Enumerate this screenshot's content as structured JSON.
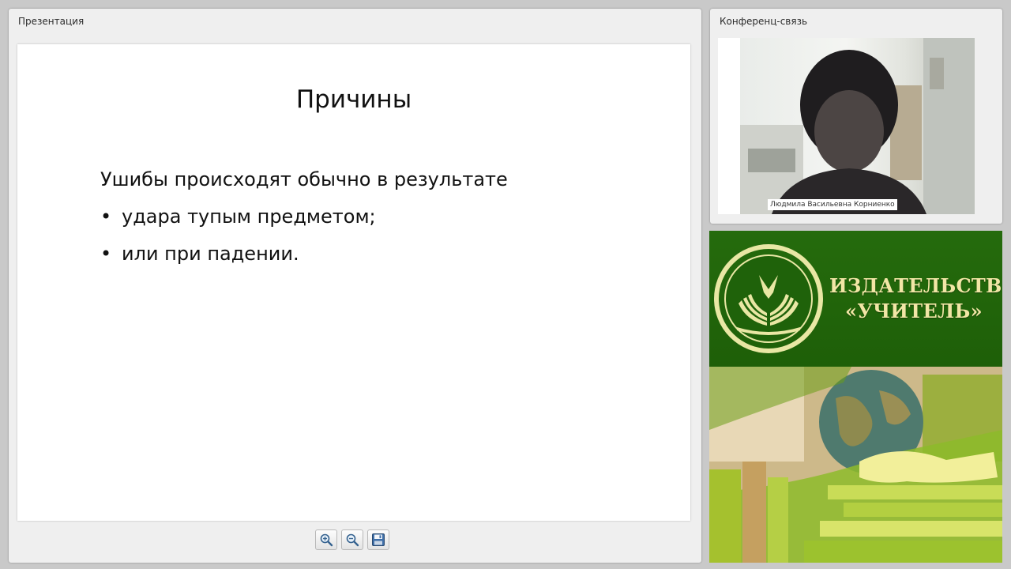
{
  "presentation": {
    "panel_title": "Презентация",
    "slide": {
      "title": "Причины",
      "lead": "Ушибы происходят обычно в результате",
      "bullets": [
        "удара тупым предметом;",
        "или при падении."
      ],
      "bullet_symbol": "•"
    },
    "toolbar": {
      "zoom_in_icon": "zoom-in-icon",
      "zoom_out_icon": "zoom-out-icon",
      "save_icon": "floppy-disk-icon"
    }
  },
  "conference": {
    "panel_title": "Конференц-связь",
    "participant_name": "Людмила Васильевна Корниенко"
  },
  "banner": {
    "line1": "ИЗДАТЕЛЬСТВО",
    "line2": "«УЧИТЕЛЬ»",
    "logo_icon": "book-leaf-emblem-icon"
  },
  "colors": {
    "background": "#c9c9c9",
    "panel": "#efefef",
    "banner_green": "#256b0d",
    "banner_text": "#f2e6a6"
  }
}
